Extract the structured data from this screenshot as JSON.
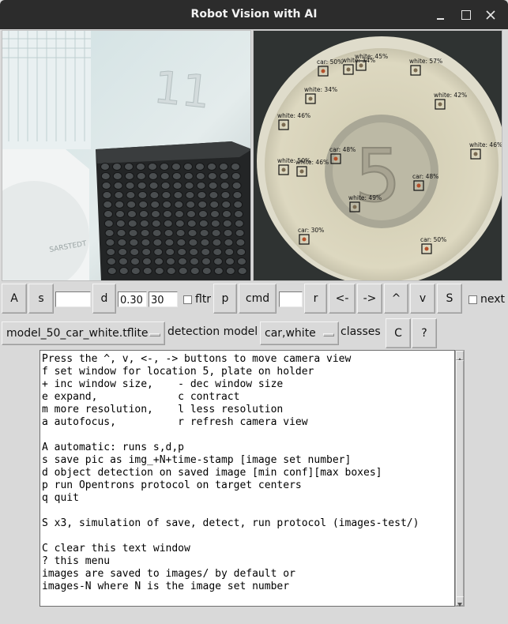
{
  "window": {
    "title": "Robot Vision with AI"
  },
  "camera": {
    "right_plate_number": "5",
    "left_plate_number": "11",
    "left_label": "SARSTEDT",
    "detections": [
      {
        "label": "car: 50%"
      },
      {
        "label": "white: 34%"
      },
      {
        "label": "white: 45%"
      },
      {
        "label": "white: 57%"
      },
      {
        "label": "white: 34%"
      },
      {
        "label": "white: 42%"
      },
      {
        "label": "white: 46%"
      },
      {
        "label": "white: 46%"
      },
      {
        "label": "car: 48%"
      },
      {
        "label": "white: 50%"
      },
      {
        "label": "white: 46%"
      },
      {
        "label": "car: 48%"
      },
      {
        "label": "white: 49%"
      },
      {
        "label": "car: 30%"
      },
      {
        "label": "car: 50%"
      }
    ]
  },
  "toolbar": {
    "a_label": "A",
    "s_label": "s",
    "s_value": "",
    "d_label": "d",
    "conf_value": "0.30",
    "max_value": "30",
    "fltr_label": "fltr",
    "p_label": "p",
    "cmd_label": "cmd",
    "cmd_value": "",
    "r_label": "r",
    "left_label": "<-",
    "right_label": "->",
    "up_label": "^",
    "down_label": "v",
    "sim_label": "S",
    "next_label": "next"
  },
  "model_row": {
    "model_value": "model_50_car_white.tflite",
    "model_caption": "detection model",
    "classes_value": "car,white",
    "classes_caption": "classes",
    "clear_label": "C",
    "help_label": "?"
  },
  "help_text": [
    "Press the ^, v, <-, -> buttons to move camera view",
    "f set window for location 5, plate on holder",
    "+ inc window size,    - dec window size",
    "e expand,             c contract",
    "m more resolution,    l less resolution",
    "a autofocus,          r refresh camera view",
    "",
    "A automatic: runs s,d,p",
    "s save pic as img_+N+time-stamp [image set number]",
    "d object detection on saved image [min conf][max boxes]",
    "p run Opentrons protocol on target centers",
    "q quit",
    "",
    "S x3, simulation of save, detect, run protocol (images-test/)",
    "",
    "C clear this text window",
    "? this menu",
    "images are saved to images/ by default or",
    "images-N where N is the image set number"
  ],
  "colors": {
    "titlebar": "#2c2c2c",
    "window_bg": "#d9d9d9",
    "box": "#111111"
  }
}
